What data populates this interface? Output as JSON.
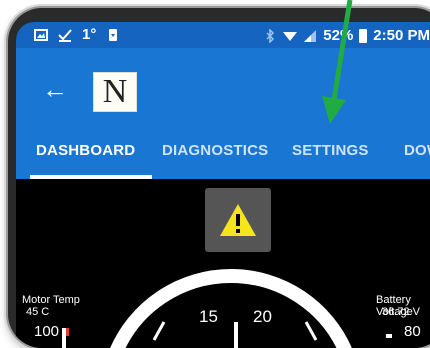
{
  "status_bar": {
    "temperature": "1°",
    "battery_percent": "52%",
    "time": "2:50 PM"
  },
  "app_bar": {
    "logo_letter": "N"
  },
  "tabs": [
    {
      "label": "DASHBOARD",
      "active": true
    },
    {
      "label": "DIAGNOSTICS",
      "active": false
    },
    {
      "label": "SETTINGS",
      "active": false
    },
    {
      "label": "DOW",
      "active": false
    }
  ],
  "dashboard": {
    "motor_temp_label": "Motor Temp",
    "motor_temp_value": "45 C",
    "motor_temp_scale": "100",
    "battery_voltage_label": "Battery Voltage",
    "battery_voltage_value": "36.72 V",
    "battery_voltage_scale": "80",
    "speedo_tick_1": "15",
    "speedo_tick_2": "20"
  },
  "colors": {
    "app_bar": "#1976d2",
    "status_bar": "#1565c0",
    "annotation_arrow": "#22aa44",
    "warning": "#f5e51a"
  }
}
